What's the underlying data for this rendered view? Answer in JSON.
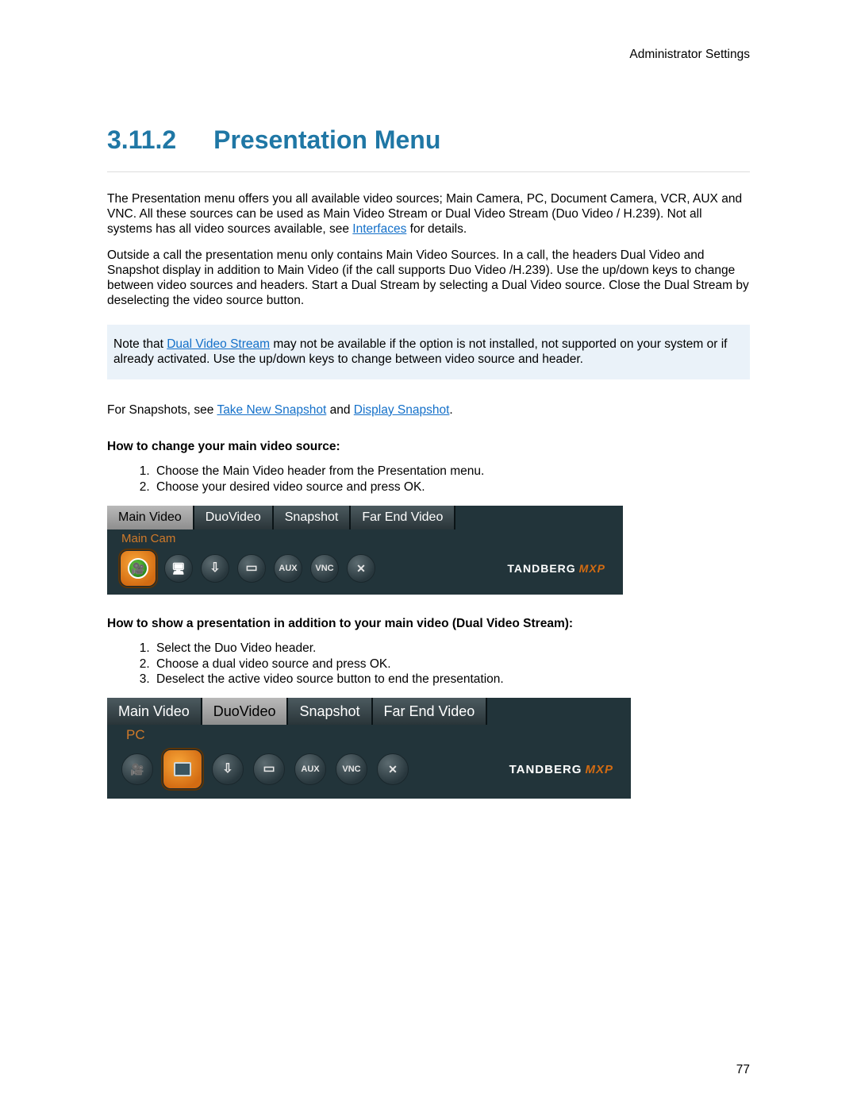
{
  "header": {
    "section": "Administrator Settings"
  },
  "title": {
    "number": "3.11.2",
    "text": "Presentation Menu"
  },
  "para1a": "The Presentation menu offers you all available video sources; Main Camera, PC, Document Camera, VCR, AUX and VNC. All these sources can be used as Main Video Stream or Dual Video Stream (Duo Video / H.239). Not all systems has all video sources available, see ",
  "para1_link": "Interfaces",
  "para1b": " for details.",
  "para2": "Outside a call the presentation menu only contains Main Video Sources. In a call, the headers Dual Video and Snapshot display in addition to Main Video (if the call supports Duo Video /H.239). Use the up/down keys to change between video sources and headers. Start a Dual Stream by selecting a Dual Video source. Close the Dual Stream by deselecting the video source button.",
  "note_a": "Note that ",
  "note_link": "Dual Video Stream",
  "note_b": " may not be available if the option is not installed, not supported on your system or if already activated. Use the up/down keys to change between video source and header.",
  "snap_a": "For Snapshots, see ",
  "snap_link1": "Take New Snapshot",
  "snap_mid": " and ",
  "snap_link2": "Display Snapshot",
  "snap_end": ".",
  "howto1_title": "How to change your main video source:",
  "howto1_steps": [
    "Choose the Main Video header from the Presentation menu.",
    "Choose your desired video source and press OK."
  ],
  "howto2_title": "How to show a presentation in addition to your main video (Dual Video Stream):",
  "howto2_steps": [
    "Select the Duo Video header.",
    "Choose a dual video source and press OK.",
    "Deselect the active video source button to end the presentation."
  ],
  "ui": {
    "tabs": [
      "Main Video",
      "DuoVideo",
      "Snapshot",
      "Far End Video"
    ],
    "sub_maincam": "Main Cam",
    "sub_pc": "PC",
    "btn_aux": "AUX",
    "btn_vnc": "VNC",
    "brand": "TANDBERG",
    "brand_suffix": "MXP"
  },
  "page_number": "77"
}
